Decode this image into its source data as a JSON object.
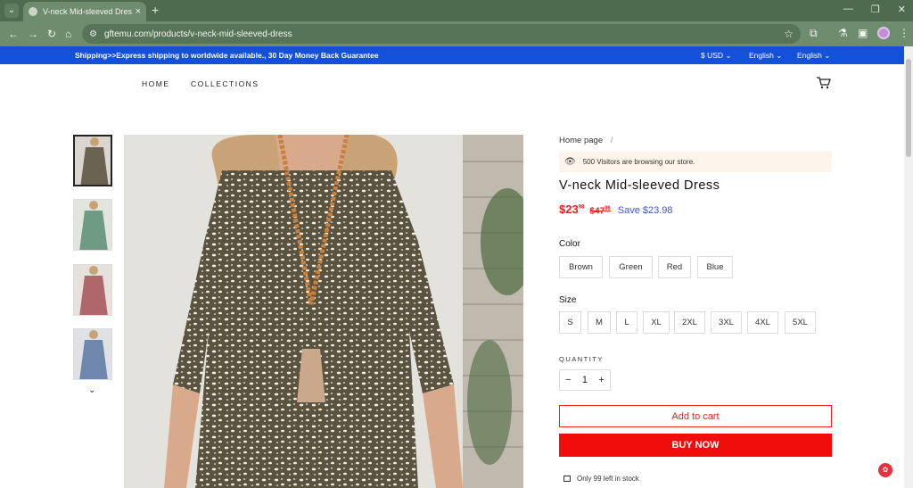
{
  "browser": {
    "tab_title": "V-neck Mid-sleeved Dress - gf",
    "url": "gftemu.com/products/v-neck-mid-sleeved-dress"
  },
  "announcement": {
    "text": "Shipping>>Express shipping to worldwide available.,  30 Day Money Back Guarantee",
    "currency": "$ USD",
    "language_1": "English",
    "language_2": "English"
  },
  "nav": {
    "home": "HOME",
    "collections": "COLLECTIONS"
  },
  "product": {
    "breadcrumb": "Home page",
    "breadcrumb_sep": "/",
    "visitors": "500 Visitors are browsing our store.",
    "title": "V-neck Mid-sleeved Dress",
    "price_main": "$23",
    "price_cents": "98",
    "old_price_main": "$47",
    "old_price_cents": "96",
    "save": "Save $23.98",
    "color_label": "Color",
    "colors": [
      "Brown",
      "Green",
      "Red",
      "Blue"
    ],
    "size_label": "Size",
    "sizes": [
      "S",
      "M",
      "L",
      "XL",
      "2XL",
      "3XL",
      "4XL",
      "5XL"
    ],
    "quantity_label": "QUANTITY",
    "quantity": "1",
    "add_to_cart": "Add to cart",
    "buy_now": "BUY NOW",
    "stock": "Only 99 left in stock"
  },
  "colors": {
    "announce_bar": "#1451db",
    "price": "#e32222",
    "save": "#3a57c9",
    "buy_now": "#f20d0d"
  }
}
